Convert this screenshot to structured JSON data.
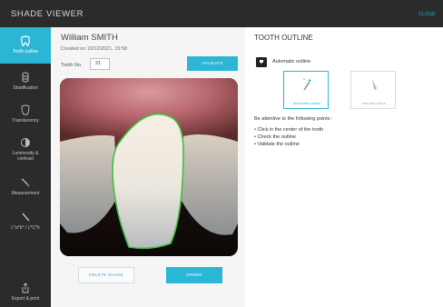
{
  "app": {
    "title": "SHADE VIEWER",
    "close_label": "CLOSE"
  },
  "colors": {
    "accent": "#2bb6d6",
    "sidebar_bg": "#2b2b2b",
    "outline": "#3fc23f"
  },
  "sidebar": {
    "items": [
      {
        "label": "Tooth outline",
        "icon": "tooth-icon",
        "active": true
      },
      {
        "label": "Stratification",
        "icon": "layers-icon",
        "active": false
      },
      {
        "label": "Translucency",
        "icon": "translucency-icon",
        "active": false
      },
      {
        "label": "Luminosity & contrast",
        "icon": "contrast-icon",
        "active": false
      },
      {
        "label": "Measurement",
        "icon": "ruler-icon",
        "active": false
      },
      {
        "label": "L*a*b* / L*C*h",
        "icon": "pipette-icon",
        "active": false
      },
      {
        "label": "Export & print",
        "icon": "export-icon",
        "active": false
      }
    ]
  },
  "patient": {
    "name": "William SMITH",
    "created": "Created on 10/12/2021, 15:58"
  },
  "tooth": {
    "label": "Tooth No.",
    "value": "21"
  },
  "buttons": {
    "validate": "VALIDATE",
    "delete_shade": "DELETE SHADE",
    "order": "ORDER"
  },
  "right": {
    "title": "TOOTH OUTLINE",
    "mode_label": "Automatic outline",
    "options": [
      {
        "label": "Automatic outline",
        "icon": "magic-wand-icon",
        "selected": true
      },
      {
        "label": "Manual outline",
        "icon": "pen-icon",
        "selected": false
      }
    ],
    "instructions_heading": "Be attentive to the following points :",
    "instructions": [
      "• Click in the center of the tooth",
      "• Check the outline",
      "• Validate the outline"
    ]
  }
}
